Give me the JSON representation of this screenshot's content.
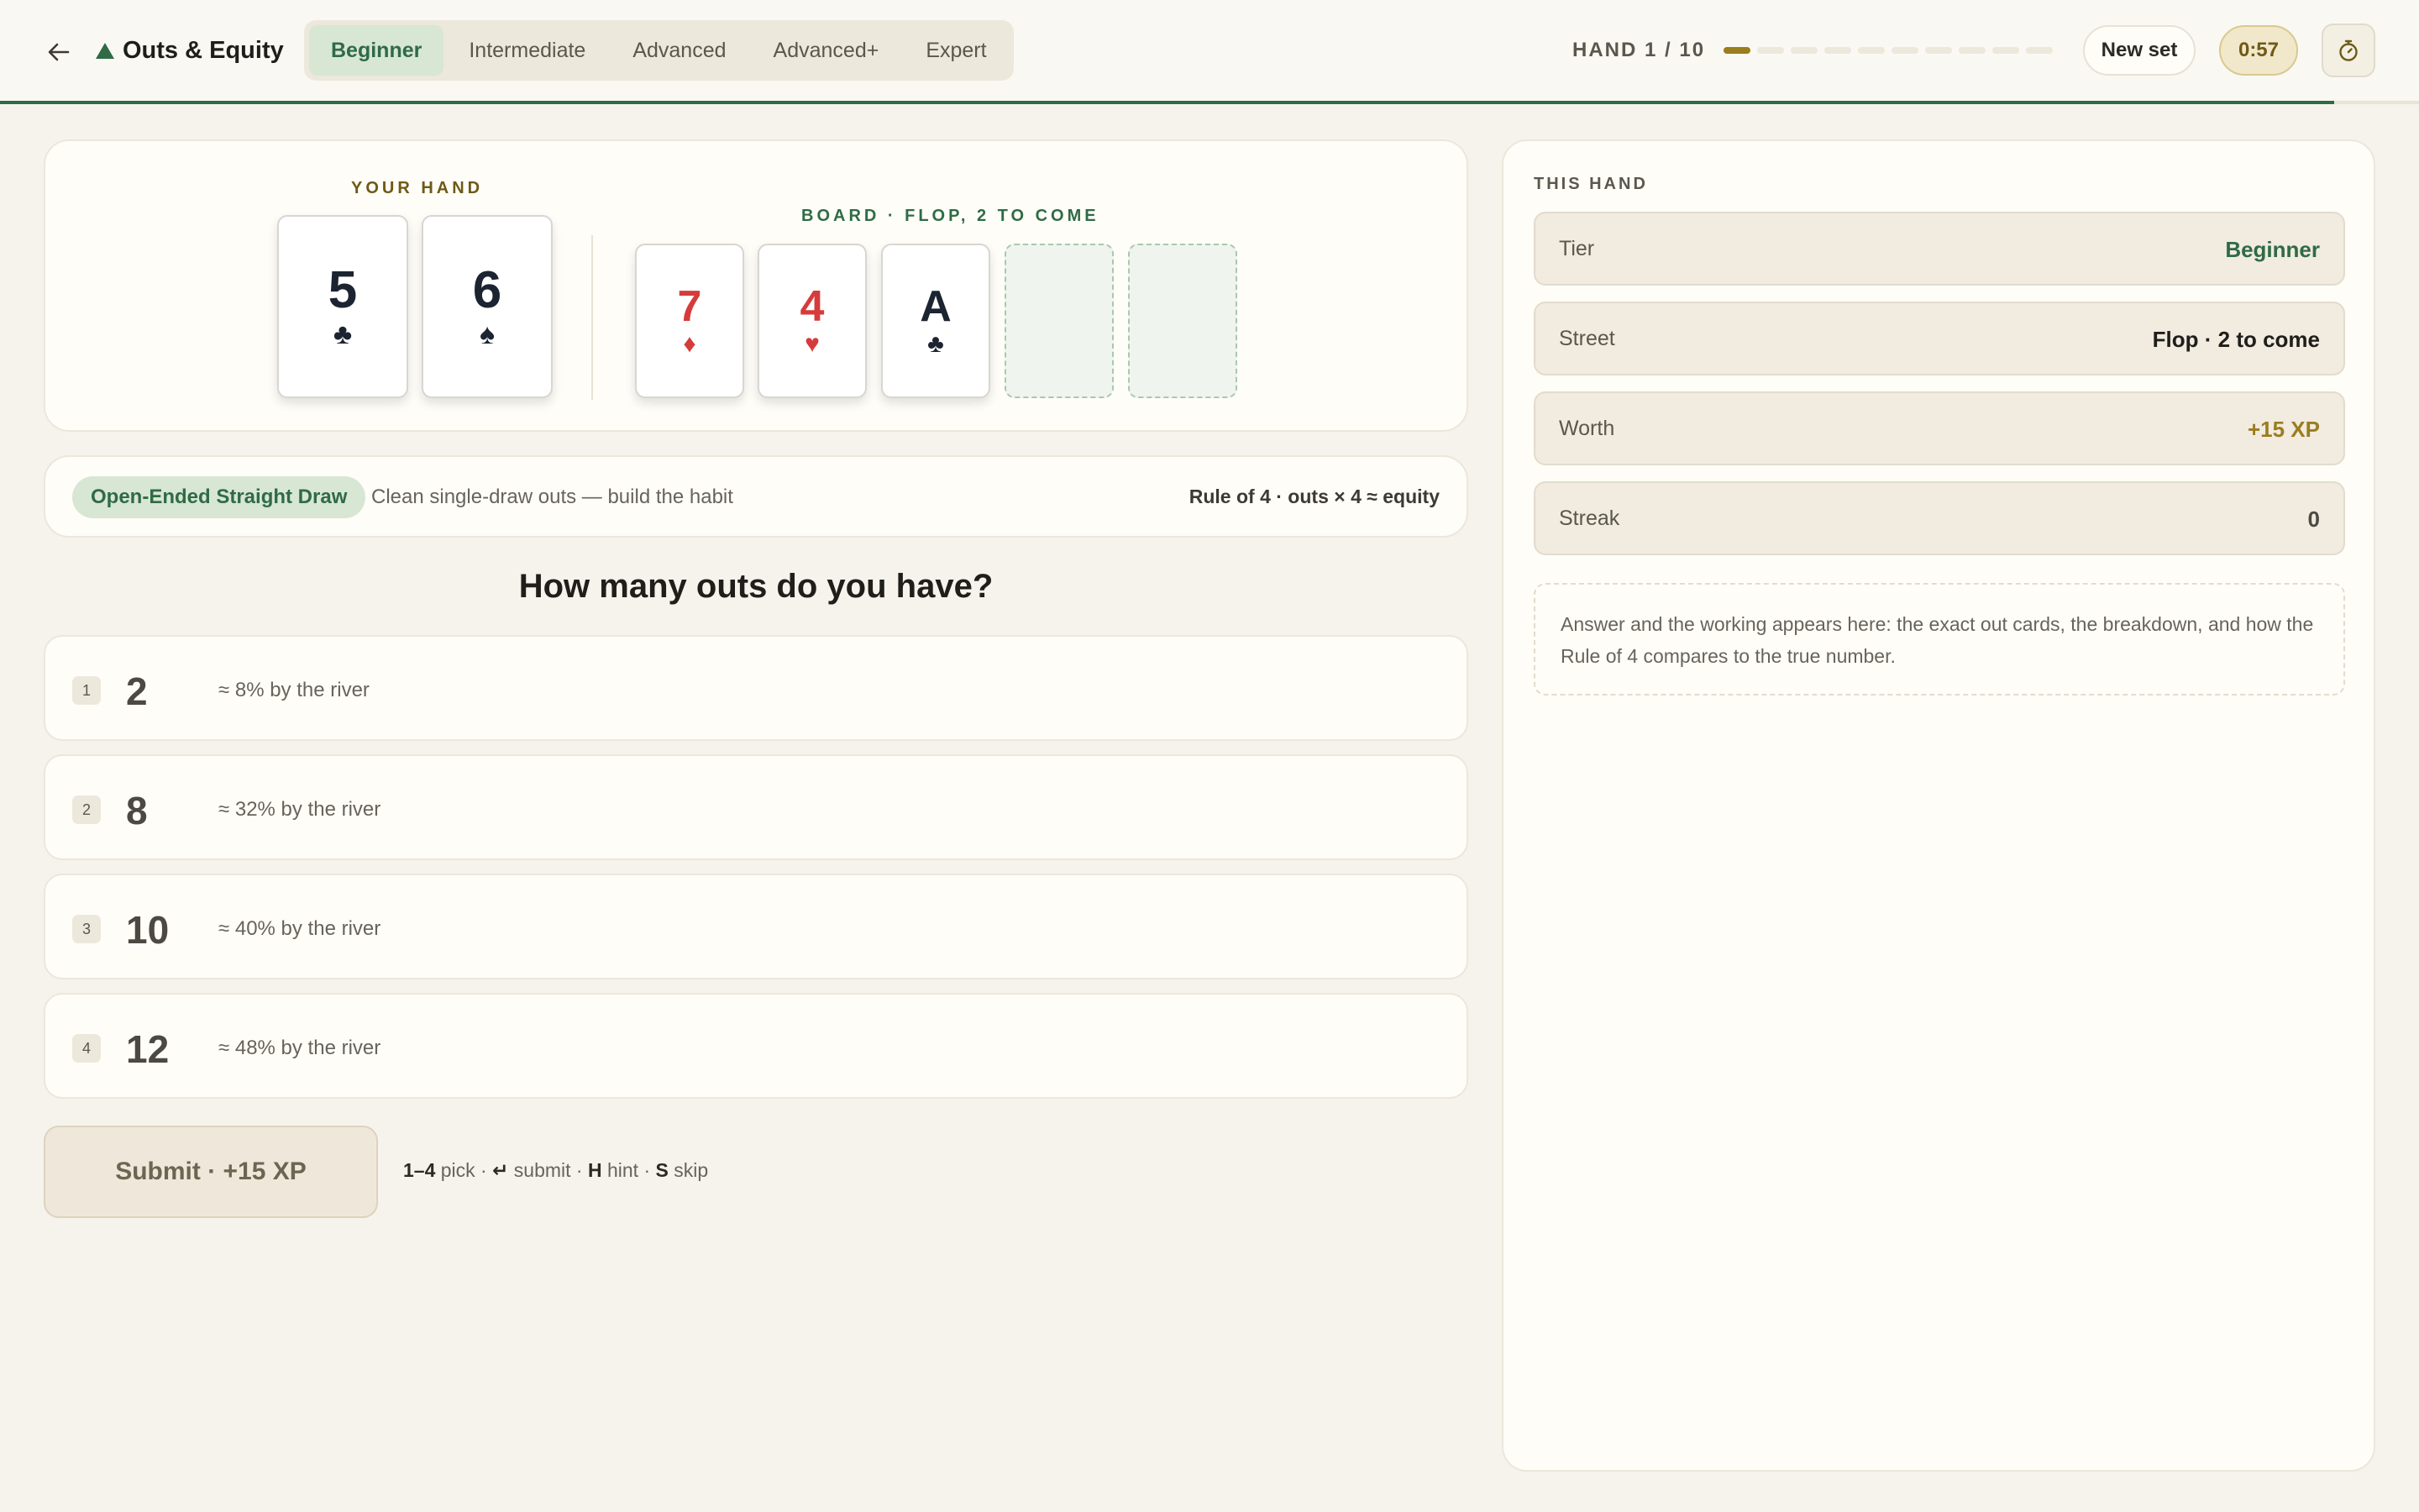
{
  "header": {
    "title": "Outs & Equity",
    "tiers": [
      "Beginner",
      "Intermediate",
      "Advanced",
      "Advanced+",
      "Expert"
    ],
    "active_tier": "Beginner",
    "hand_counter": "HAND 1 / 10",
    "hand_progress": {
      "current": 1,
      "total": 10
    },
    "new_set_label": "New set",
    "timer": "0:57",
    "session_progress_fraction": 0.965
  },
  "hand": {
    "your_hand_label": "YOUR HAND",
    "board_label": "BOARD · FLOP, 2 TO COME",
    "hole_cards": [
      {
        "rank": "5",
        "suit": "♣",
        "color": "black"
      },
      {
        "rank": "6",
        "suit": "♠",
        "color": "black"
      }
    ],
    "board_cards": [
      {
        "rank": "7",
        "suit": "♦",
        "color": "red"
      },
      {
        "rank": "4",
        "suit": "♥",
        "color": "red"
      },
      {
        "rank": "A",
        "suit": "♣",
        "color": "black"
      }
    ],
    "empty_board_slots": 2
  },
  "strip": {
    "badge": "Open-Ended Straight Draw",
    "description": "Clean single-draw outs — build the habit",
    "rule": "Rule of 4 · outs × 4 ≈ equity"
  },
  "question": "How many outs do you have?",
  "options": [
    {
      "key": "1",
      "value": "2",
      "equity": "≈ 8% by the river"
    },
    {
      "key": "2",
      "value": "8",
      "equity": "≈ 32% by the river"
    },
    {
      "key": "3",
      "value": "10",
      "equity": "≈ 40% by the river"
    },
    {
      "key": "4",
      "value": "12",
      "equity": "≈ 48% by the river"
    }
  ],
  "submit_label": "Submit · +15 XP",
  "shortcuts": {
    "pick_key": "1–4",
    "pick_text": "pick ·",
    "submit_key": "↵",
    "submit_text": "submit ·",
    "hint_key": "H",
    "hint_text": "hint ·",
    "skip_key": "S",
    "skip_text": "skip"
  },
  "side": {
    "title": "THIS HAND",
    "rows": [
      {
        "label": "Tier",
        "value": "Beginner"
      },
      {
        "label": "Street",
        "value": "Flop · 2 to come"
      },
      {
        "label": "Worth",
        "value": "+15 XP"
      },
      {
        "label": "Streak",
        "value": "0"
      }
    ],
    "explanation": "Answer and the working appears here: the exact out cards, the breakdown, and how the Rule of 4 compares to the true number."
  },
  "colors": {
    "accent_green": "#2f6b45",
    "gold": "#9a7d1e",
    "card_red": "#d63b3b",
    "card_black": "#1b2430"
  }
}
